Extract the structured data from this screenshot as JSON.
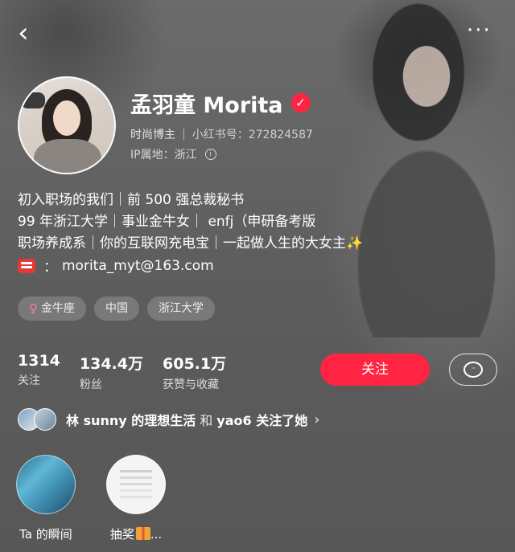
{
  "nav": {
    "back_glyph": "‹",
    "more_glyph": "···"
  },
  "profile": {
    "name": "孟羽童 Morita",
    "verified_glyph": "✓",
    "role": "时尚博主",
    "id_label": "小红书号：272824587",
    "ip_location": "IP属地：浙江",
    "info_glyph": "i"
  },
  "bio": {
    "lines": [
      "初入职场的我们｜前 500 强总裁秘书",
      "99 年浙江大学｜事业金牛女｜ enfj（申研备考版",
      "职场养成系｜你的互联网充电宝｜一起做人生的大女主✨"
    ],
    "email_sep": "：",
    "email": "morita_myt@163.com"
  },
  "tags": [
    {
      "icon": "♀",
      "label": "金牛座"
    },
    {
      "label": "中国"
    },
    {
      "label": "浙江大学"
    }
  ],
  "stats": [
    {
      "num": "1314",
      "label": "关注"
    },
    {
      "num": "134.4万",
      "label": "粉丝"
    },
    {
      "num": "605.1万",
      "label": "获赞与收藏"
    }
  ],
  "actions": {
    "follow_label": "关注",
    "chat_glyph": "···"
  },
  "mutual": {
    "bold_name": "林 sunny 的理想生活",
    "connector": "和",
    "tail": "yao6 关注了她",
    "chevron": "›"
  },
  "highlights": [
    {
      "label": "Ta 的瞬间"
    },
    {
      "label": "抽奖",
      "suffix": "..."
    }
  ],
  "colors": {
    "accent": "#ff2442",
    "background": "#5e5e5e"
  }
}
